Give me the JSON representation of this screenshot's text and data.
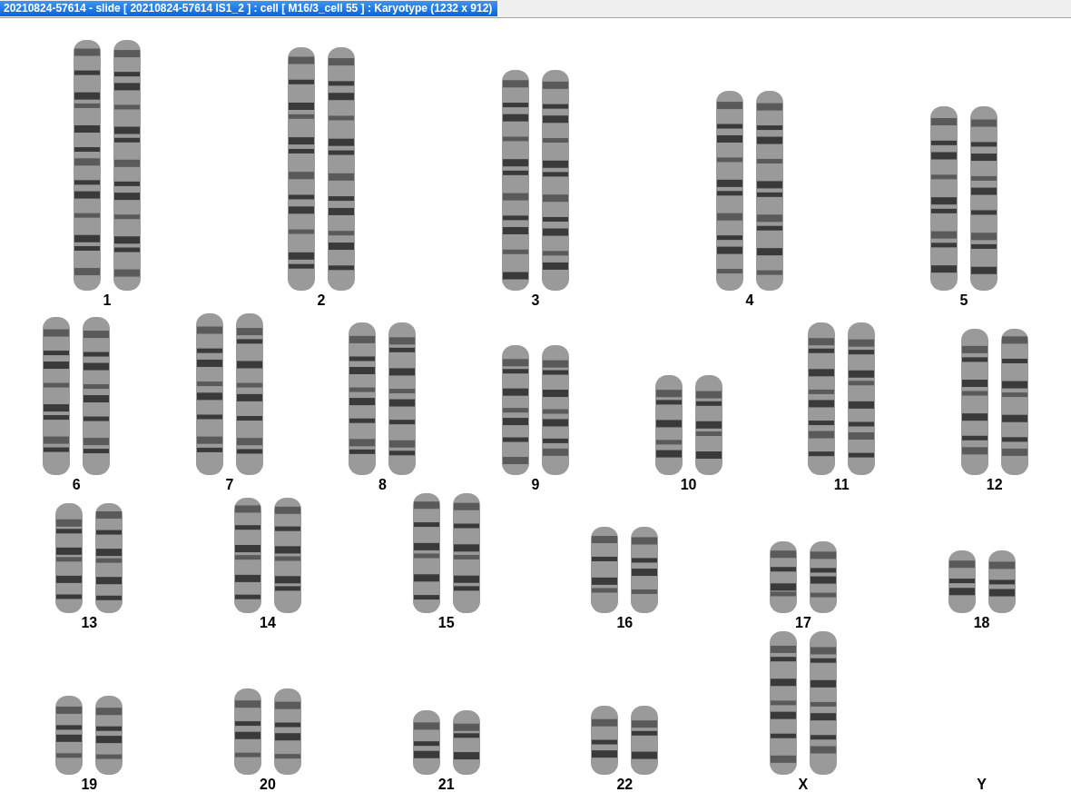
{
  "window": {
    "title": "20210824-57614 - slide [ 20210824-57614 IS1_2 ] : cell [ M16/3_cell 55 ] : Karyotype  (1232 x 912)"
  },
  "karyotype": {
    "rows": [
      [
        {
          "label": "1",
          "kind": "pair"
        },
        {
          "label": "2",
          "kind": "pair"
        },
        {
          "label": "3",
          "kind": "pair"
        },
        {
          "label": "4",
          "kind": "pair"
        },
        {
          "label": "5",
          "kind": "pair"
        }
      ],
      [
        {
          "label": "6",
          "kind": "pair"
        },
        {
          "label": "7",
          "kind": "pair"
        },
        {
          "label": "8",
          "kind": "pair"
        },
        {
          "label": "9",
          "kind": "pair"
        },
        {
          "label": "10",
          "kind": "pair"
        },
        {
          "label": "11",
          "kind": "pair"
        },
        {
          "label": "12",
          "kind": "pair"
        }
      ],
      [
        {
          "label": "13",
          "kind": "pair"
        },
        {
          "label": "14",
          "kind": "pair"
        },
        {
          "label": "15",
          "kind": "pair"
        },
        {
          "label": "16",
          "kind": "pair"
        },
        {
          "label": "17",
          "kind": "pair"
        },
        {
          "label": "18",
          "kind": "pair"
        }
      ],
      [
        {
          "label": "19",
          "kind": "pair"
        },
        {
          "label": "20",
          "kind": "pair"
        },
        {
          "label": "21",
          "kind": "pair"
        },
        {
          "label": "22",
          "kind": "pair"
        },
        {
          "label": "X",
          "kind": "pair"
        },
        {
          "label": "Y",
          "kind": "empty"
        }
      ]
    ]
  }
}
